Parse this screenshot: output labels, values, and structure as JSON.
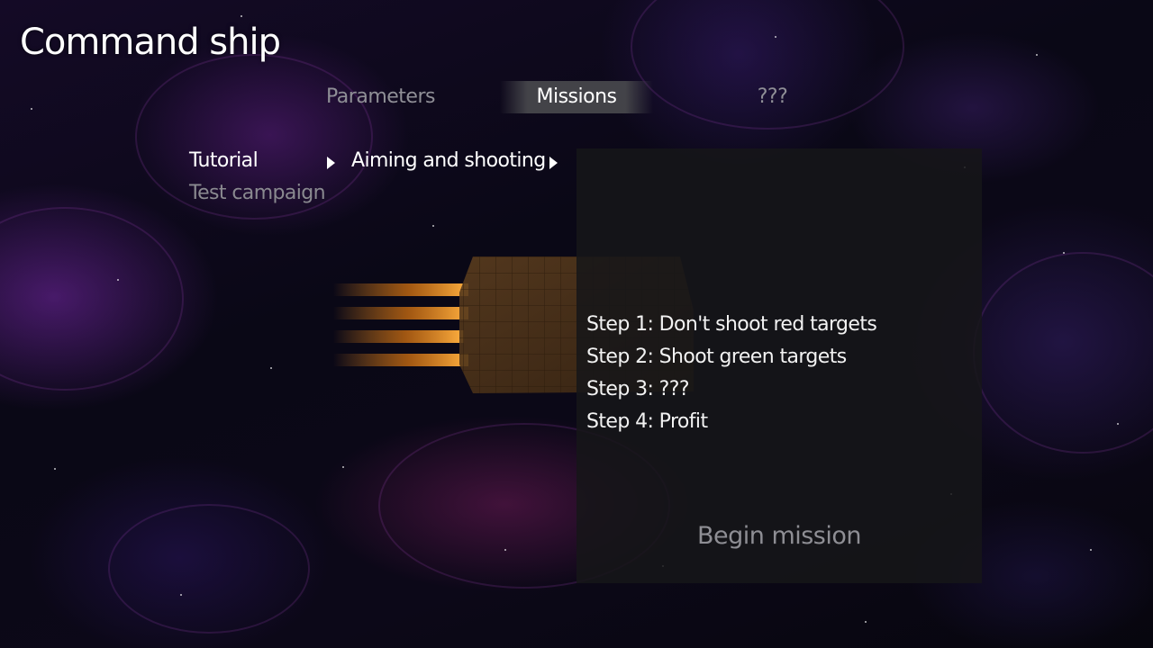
{
  "title": "Command ship",
  "tabs": [
    {
      "label": "Parameters",
      "active": false
    },
    {
      "label": "Missions",
      "active": true
    },
    {
      "label": "???",
      "active": false
    }
  ],
  "campaigns": [
    {
      "label": "Tutorial",
      "selected": true
    },
    {
      "label": "Test campaign",
      "selected": false
    }
  ],
  "missions": [
    {
      "label": "Aiming and shooting",
      "selected": true
    }
  ],
  "mission_panel": {
    "steps": [
      "Step 1: Don't shoot red targets",
      "Step 2: Shoot green targets",
      "Step 3: ???",
      "Step 4: Profit"
    ],
    "begin_label": "Begin mission"
  },
  "colors": {
    "active_text": "#ffffff",
    "inactive_text": "#8f8f96",
    "panel_bg": "#161618",
    "ship_hull": "#4a3218",
    "thruster_flame": "#e07810"
  }
}
